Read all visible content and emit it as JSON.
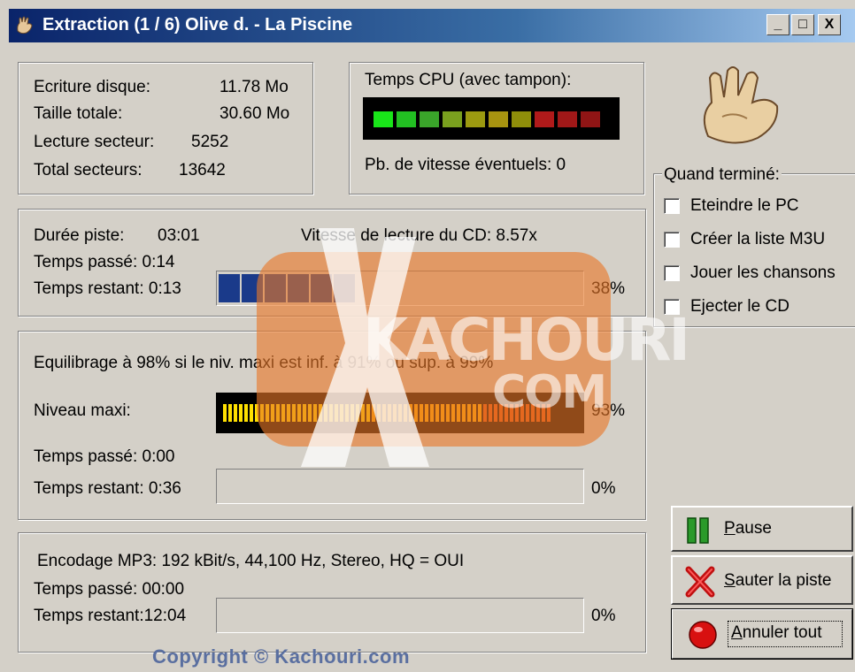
{
  "window": {
    "title": "Extraction (1 / 6)  Olive d. - La Piscine",
    "minimize": "_",
    "maximize": "□",
    "close": "X"
  },
  "disk": {
    "ecriture_label": "Ecriture disque:",
    "ecriture_value": "11.78 Mo",
    "taille_label": "Taille totale:",
    "taille_value": "30.60 Mo",
    "lecture_label": "Lecture secteur:",
    "lecture_value": "5252",
    "total_label": "Total secteurs:",
    "total_value": "13642"
  },
  "cpu": {
    "label": "Temps CPU (avec tampon):",
    "speed_issue": "Pb. de vitesse éventuels: 0",
    "segment_colors": [
      "#19e619",
      "#22c022",
      "#3aa52a",
      "#7aa01e",
      "#9c9a10",
      "#a89410",
      "#8f8e0a",
      "#b01a1a",
      "#a01818",
      "#901515"
    ]
  },
  "track": {
    "duree_label": "Durée piste:",
    "duree_value": "03:01",
    "vitesse": "Vitesse de lecture du CD: 8.57x",
    "passe": "Temps passé:  0:14",
    "restant": "Temps restant:  0:13",
    "percent": "38%",
    "progress": 0.38
  },
  "level": {
    "equilibrage": "Equilibrage à 98% si le niv. maxi est inf. à 91% ou sup. à 99%",
    "niveau_label": "Niveau maxi:",
    "niveau_percent": "93%",
    "niveau_value": 0.93,
    "passe": "Temps passé:   0:00",
    "restant": "Temps restant:  0:36",
    "percent": "0%"
  },
  "encode": {
    "info": "Encodage MP3: 192 kBit/s, 44,100 Hz, Stereo, HQ = OUI",
    "passe": "Temps passé:  00:00",
    "restant": "Temps restant:12:04",
    "percent": "0%"
  },
  "quand": {
    "title": "Quand terminé:",
    "options": [
      "Eteindre le PC",
      "Créer la liste M3U",
      "Jouer les chansons",
      "Ejecter le CD"
    ]
  },
  "buttons": {
    "pause_hot": "P",
    "pause_rest": "ause",
    "sauter_hot": "S",
    "sauter_rest": "auter la piste",
    "annuler_hot": "A",
    "annuler_rest": "nnuler tout"
  },
  "watermark": {
    "brand": "KACHOURI",
    "domain": "COM"
  },
  "copyright": "Copyright © Kachouri.com"
}
